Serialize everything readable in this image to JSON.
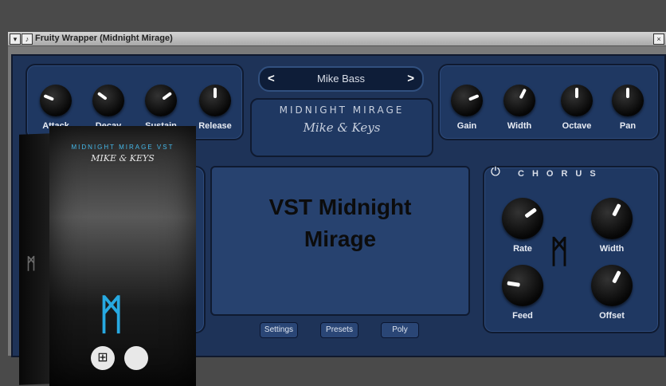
{
  "window": {
    "title": "Fruity Wrapper (Midnight Mirage)"
  },
  "preset": {
    "name": "Mike Bass",
    "prev": "<",
    "next": ">"
  },
  "brand": {
    "line1": "MIDNIGHT MIRAGE",
    "line2": "Mike & Keys"
  },
  "left_knobs": [
    {
      "label": "Attack",
      "value": 0.25
    },
    {
      "label": "Decay",
      "value": 0.3
    },
    {
      "label": "Sustain",
      "value": 0.7
    },
    {
      "label": "Release",
      "value": 0.5
    }
  ],
  "right_knobs": [
    {
      "label": "Gain",
      "value": 0.75
    },
    {
      "label": "Width",
      "value": 0.6
    },
    {
      "label": "Octave",
      "value": 0.5
    },
    {
      "label": "Pan",
      "value": 0.5
    }
  ],
  "display": {
    "line1": "VST Midnight",
    "line2": "Mirage"
  },
  "buttons": {
    "settings": "Settings",
    "presets": "Presets",
    "poly": "Poly"
  },
  "chorus": {
    "title": "CHORUS",
    "power": "⏻",
    "knobs": [
      {
        "label": "Rate",
        "value": 0.7
      },
      {
        "label": "Width",
        "value": 0.6
      },
      {
        "label": "Feed",
        "value": 0.2
      },
      {
        "label": "Offset",
        "value": 0.6
      }
    ],
    "logo": "ᛗ"
  },
  "product_box": {
    "title": "MIDNIGHT MIRAGE VST",
    "subtitle": "MIKE & KEYS",
    "logo": "ᛗ",
    "os_windows": "⊞",
    "os_apple": ""
  },
  "colors": {
    "panel": "#1e3358",
    "accent": "#44b7e8"
  }
}
